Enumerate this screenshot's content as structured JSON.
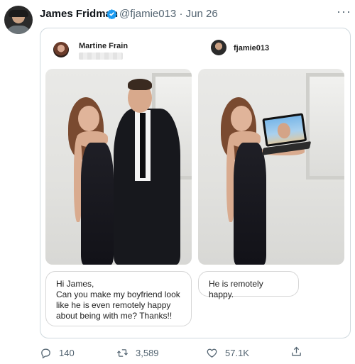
{
  "tweet": {
    "author_name": "James Fridman",
    "handle": "@fjamie013",
    "separator": "·",
    "date": "Jun 26",
    "more_label": "···"
  },
  "left_panel": {
    "username": "Martine Frain",
    "message_lines": [
      "Hi James,",
      "Can you make my boyfriend look",
      "like he is even remotely happy",
      "about being with me? Thanks!!"
    ]
  },
  "right_panel": {
    "username": "fjamie013",
    "message": "He is remotely happy."
  },
  "actions": {
    "replies": "140",
    "retweets": "3,589",
    "likes": "57.1K"
  },
  "colors": {
    "verified": "#1d9bf0",
    "muted_text": "#536471",
    "border": "#cfd9de"
  },
  "icons": [
    "reply-icon",
    "retweet-icon",
    "like-icon",
    "share-icon",
    "verified-badge-icon",
    "more-icon"
  ]
}
